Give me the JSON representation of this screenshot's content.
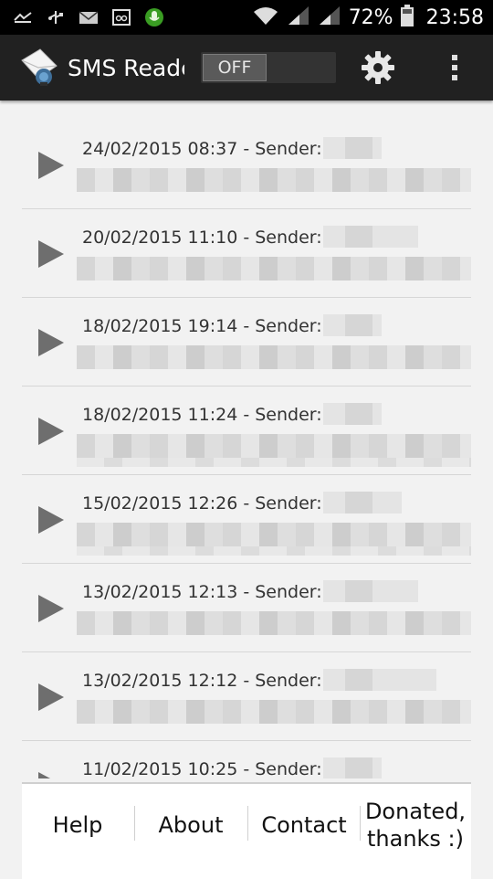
{
  "status_bar": {
    "battery_pct": "72%",
    "time": "23:58",
    "icons": [
      "missed-call-icon",
      "usb-icon",
      "email-icon",
      "voicemail-icon",
      "mic-icon",
      "wifi-icon",
      "signal-icon",
      "signal-icon",
      "battery-icon"
    ]
  },
  "action_bar": {
    "title": "SMS Reader",
    "toggle_label": "OFF",
    "colors": {
      "background": "#212121",
      "mic_accent": "#3a9d23"
    }
  },
  "messages": [
    {
      "header": "24/02/2015 08:37 - Sender:"
    },
    {
      "header": "20/02/2015 11:10 - Sender:"
    },
    {
      "header": "18/02/2015 19:14 - Sender:"
    },
    {
      "header": "18/02/2015 11:24 - Sender:"
    },
    {
      "header": "15/02/2015 12:26 - Sender:"
    },
    {
      "header": "13/02/2015 12:13 - Sender:"
    },
    {
      "header": "13/02/2015 12:12 - Sender:"
    },
    {
      "header": "11/02/2015 10:25 - Sender:"
    }
  ],
  "bottom_bar": {
    "help": "Help",
    "about": "About",
    "contact": "Contact",
    "donated_line1": "Donated,",
    "donated_line2": "thanks :)"
  }
}
